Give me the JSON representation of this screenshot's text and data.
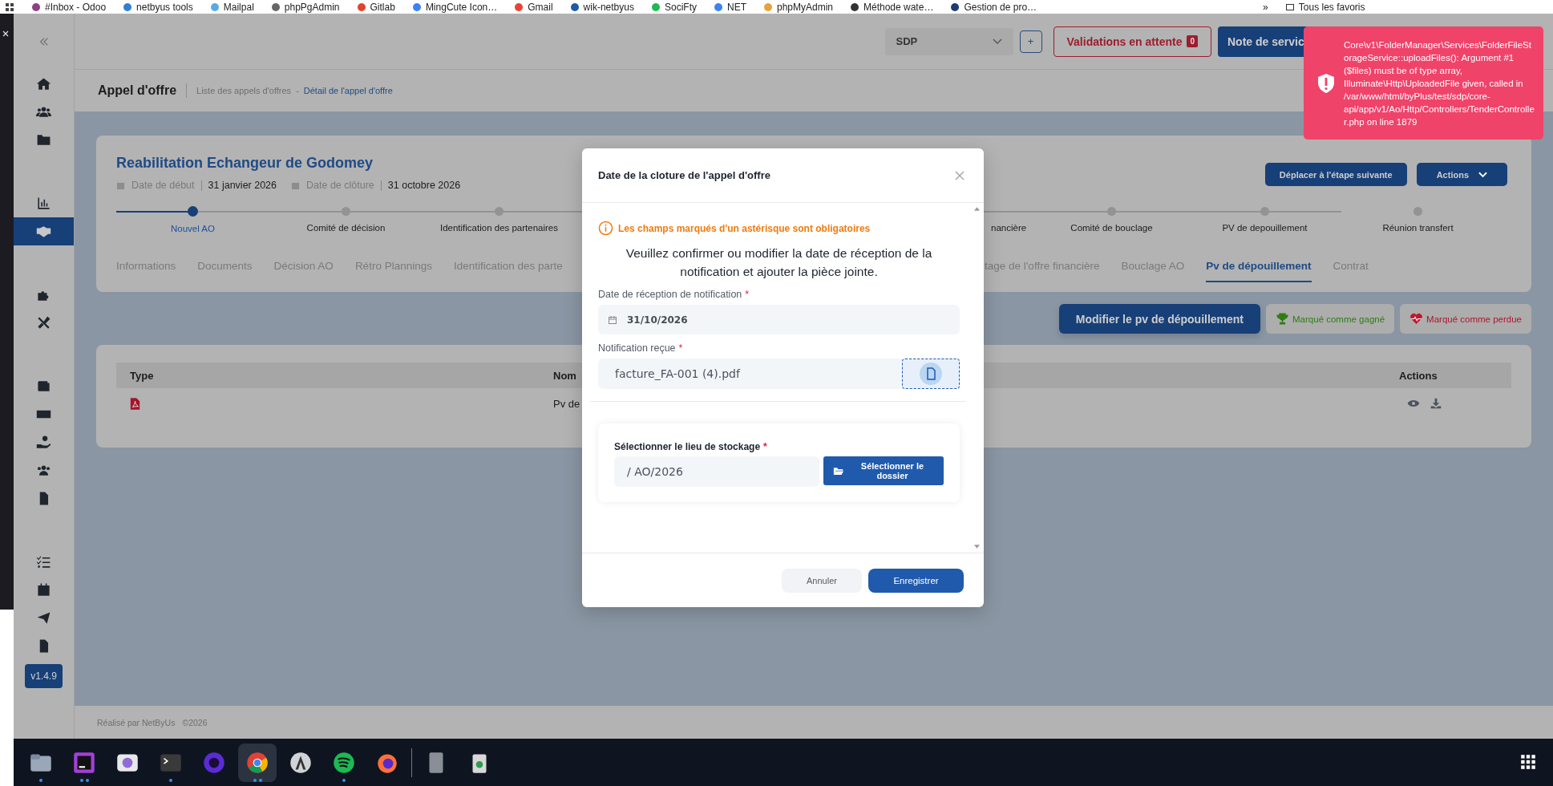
{
  "bookmarks": [
    {
      "label": "#Inbox - Odoo",
      "color": "#8e3f86"
    },
    {
      "label": "netbyus tools",
      "color": "#2f7fd8"
    },
    {
      "label": "Mailpal",
      "color": "#5aa9e6"
    },
    {
      "label": "phpPgAdmin",
      "color": "#666666"
    },
    {
      "label": "Gitlab",
      "color": "#e2432a"
    },
    {
      "label": "MingCute Icon…",
      "color": "#3b82f6"
    },
    {
      "label": "Gmail",
      "color": "#ea4335"
    },
    {
      "label": "wik-netbyus",
      "color": "#1e5aa8"
    },
    {
      "label": "SociFty",
      "color": "#1db954"
    },
    {
      "label": "NET",
      "color": "#3b82f6"
    },
    {
      "label": "phpMyAdmin",
      "color": "#e8a23a"
    },
    {
      "label": "Méthode wate…",
      "color": "#333333"
    },
    {
      "label": "Gestion de pro…",
      "color": "#1e3a6e"
    }
  ],
  "bookmarks_more": "»",
  "all_bookmarks": "Tous les favoris",
  "sidebar": {
    "groups": [
      {
        "items": [
          {
            "selected": false
          },
          {
            "selected": false
          },
          {
            "selected": false
          }
        ]
      },
      {
        "items": [
          {
            "selected": false
          },
          {
            "selected": true
          }
        ]
      },
      {
        "items": [
          {
            "selected": false
          },
          {
            "selected": false
          }
        ]
      },
      {
        "items": [
          {
            "selected": false
          },
          {
            "selected": false
          },
          {
            "selected": false
          },
          {
            "selected": false
          },
          {
            "selected": false
          }
        ]
      },
      {
        "items": [
          {
            "selected": false
          },
          {
            "selected": false
          },
          {
            "selected": false
          },
          {
            "selected": false
          }
        ]
      }
    ],
    "version": "v1.4.9"
  },
  "topbar": {
    "project": "SDP",
    "add": "+",
    "validations": "Validations en attente",
    "validations_count": "0",
    "note": "Note de servic"
  },
  "breadcrumb": {
    "title": "Appel d'offre",
    "items": [
      {
        "label": "Liste des appels d'offres",
        "selected": false
      },
      {
        "label": "Détail de l'appel d'offre",
        "selected": true
      }
    ],
    "separator": "-"
  },
  "tender": {
    "title": "Reabilitation Echangeur de Godomey",
    "start_label": "Date de début",
    "start_date": "31 janvier 2026",
    "end_label": "Date de clôture",
    "end_date": "31 octobre 2026",
    "next_step": "Déplacer à l'étape suivante",
    "actions": "Actions",
    "steps": [
      {
        "label": "Nouvel AO",
        "selected": true,
        "kind": "full"
      },
      {
        "label": "Comité de décision",
        "selected": false,
        "kind": "full"
      },
      {
        "label": "Identification des partenaires",
        "selected": false,
        "kind": "full"
      },
      {
        "label": "nancière",
        "selected": false,
        "kind": "cut"
      },
      {
        "label": "Comité de bouclage",
        "selected": false,
        "kind": "full"
      },
      {
        "label": "PV de depouillement",
        "selected": false,
        "kind": "full"
      },
      {
        "label": "Réunion transfert",
        "selected": false,
        "kind": "full"
      }
    ],
    "tabs_left": [
      {
        "label": "Informations",
        "selected": false
      },
      {
        "label": "Documents",
        "selected": false
      },
      {
        "label": "Décision AO",
        "selected": false
      },
      {
        "label": "Rétro Plannings",
        "selected": false
      },
      {
        "label": "Identification des parte",
        "selected": false
      }
    ],
    "tabs_right": [
      {
        "label": "tage de l'offre financière",
        "selected": false
      },
      {
        "label": "Bouclage AO",
        "selected": false
      },
      {
        "label": "Pv de dépouillement",
        "selected": true
      },
      {
        "label": "Contrat",
        "selected": false
      }
    ]
  },
  "toolbar": [
    {
      "label": "Modifier le pv de dépouillement",
      "kind": "primary"
    },
    {
      "label": "Marqué comme gagné",
      "kind": "won"
    },
    {
      "label": "Marqué comme perdue",
      "kind": "lost"
    }
  ],
  "documents": {
    "columns": [
      "Type",
      "Nom",
      "Actions"
    ],
    "rows": [
      {
        "name": "Pv de"
      }
    ]
  },
  "modal": {
    "title": "Date de la cloture de l'appel d'offre",
    "warning": "Les champs marqués d'un astérisque sont obligatoires",
    "intro": "Veuillez confirmer ou modifier la date de réception de la notification et ajouter la pièce jointe.",
    "date_label": "Date de réception de notification",
    "date_value": "31/10/2026",
    "file_label": "Notification reçue",
    "file_value": "facture_FA-001 (4).pdf",
    "storage_label": "Sélectionner le lieu de stockage",
    "storage_value": "/ AO/2026",
    "storage_button": "Sélectionner le dossier",
    "required": "*",
    "cancel": "Annuler",
    "save": "Enregistrer"
  },
  "toast": {
    "message": "Core\\v1\\FolderManager\\Services\\FolderFileStorageService::uploadFiles(): Argument #1 ($files) must be of type array, Illuminate\\Http\\UploadedFile given, called in /var/www/html/byPlus/test/sdp/core-api/app/v1/Ao/Http/Controllers/TenderController.php on line 1879"
  },
  "footer": {
    "credit": "Réalisé par NetByUs",
    "year": "©2026"
  },
  "taskbar": {
    "apps": [
      {
        "running": true,
        "multi": false,
        "selected": false
      },
      {
        "running": true,
        "multi": true,
        "selected": false
      },
      {
        "running": false,
        "selected": false
      },
      {
        "running": true,
        "multi": false,
        "selected": false
      },
      {
        "running": false,
        "selected": false
      },
      {
        "running": true,
        "multi": true,
        "selected": true
      },
      {
        "running": false,
        "selected": false
      },
      {
        "running": true,
        "multi": false,
        "selected": false
      },
      {
        "running": false,
        "selected": false
      },
      {
        "running": false,
        "selected": false
      },
      {
        "running": false,
        "selected": false
      }
    ]
  }
}
